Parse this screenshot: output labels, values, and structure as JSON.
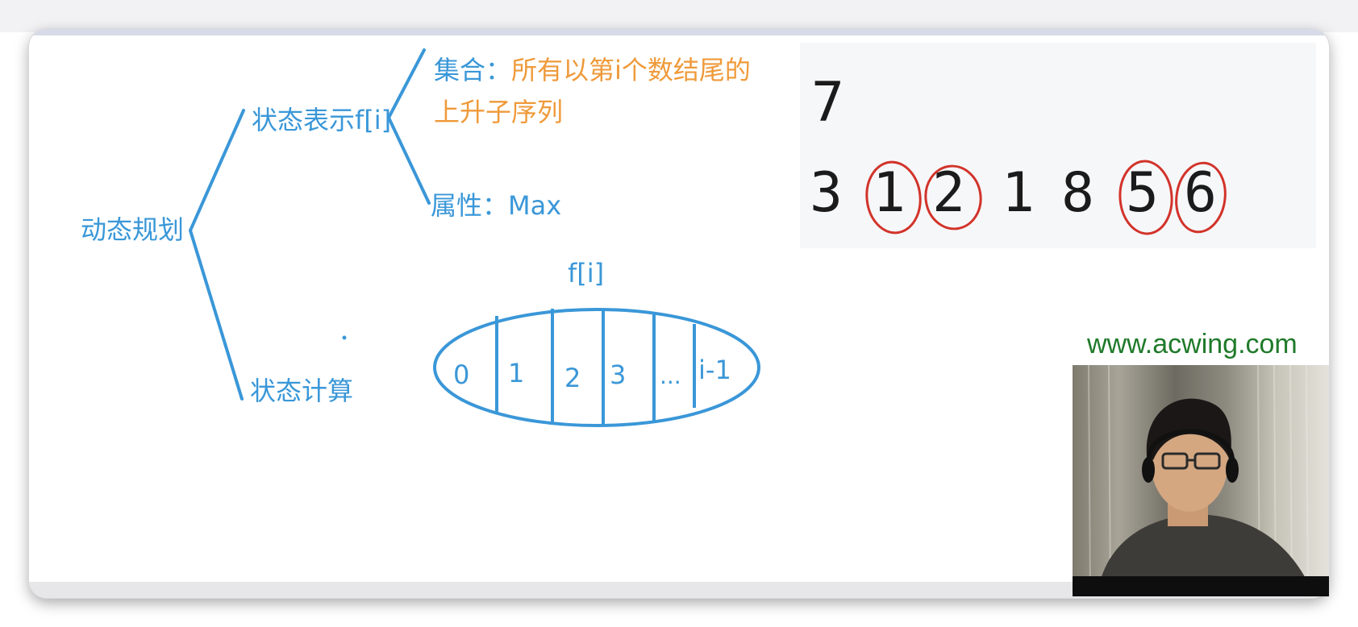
{
  "mindmap": {
    "root": "动态规划",
    "state_repr": "状态表示f[i]",
    "state_calc": "状态计算",
    "set_line1_label": "集合：",
    "set_line1_text": "所有以第i个数结尾的",
    "set_line2_text": "上升子序列",
    "attribute": "属性：Max"
  },
  "partition": {
    "title": "f[i]",
    "cells": [
      "0",
      "1",
      "2",
      "3",
      "...",
      "i-1"
    ]
  },
  "problem": {
    "n": "7",
    "sequence": [
      "3",
      "1",
      "2",
      "1",
      "8",
      "5",
      "6"
    ],
    "circled_indices": [
      1,
      2,
      5,
      6
    ]
  },
  "watermark": "www.acwing.com",
  "colors": {
    "ink_blue": "#3a97d8",
    "ink_orange": "#ef9a3a",
    "ink_red": "#d2332a",
    "url_green": "#1f7a2a"
  }
}
